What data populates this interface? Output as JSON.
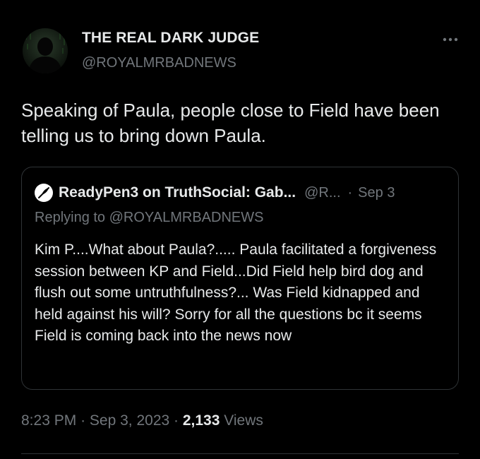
{
  "tweet": {
    "author": {
      "display_name": "THE REAL DARK JUDGE",
      "handle": "@ROYALMRBADNEWS",
      "avatar_icon": "silhouette-avatar"
    },
    "more_icon": "more-horizontal-icon",
    "text": "Speaking of Paula, people close to Field have been telling us to bring down Paula.",
    "quote": {
      "author": {
        "display_name": "ReadyPen3 on TruthSocial: Gab...",
        "handle": "@R...",
        "avatar_icon": "feather-pen-avatar"
      },
      "separator": "·",
      "date": "Sep 3",
      "replying_to": "Replying to @ROYALMRBADNEWS",
      "text": "Kim P....What about Paula?..... Paula facilitated a forgiveness session between KP and Field...Did Field help bird dog and flush out some untruthfulness?... Was Field kidnapped and held against his will? Sorry for all the questions bc it seems Field is coming back into the news now"
    },
    "meta": {
      "time": "8:23 PM",
      "separator": "·",
      "date": "Sep 3, 2023",
      "views_count": "2,133",
      "views_label": "Views"
    }
  },
  "colors": {
    "background": "#000000",
    "primary_text": "#e7e9ea",
    "secondary_text": "#71767b",
    "border": "#2f3336"
  }
}
